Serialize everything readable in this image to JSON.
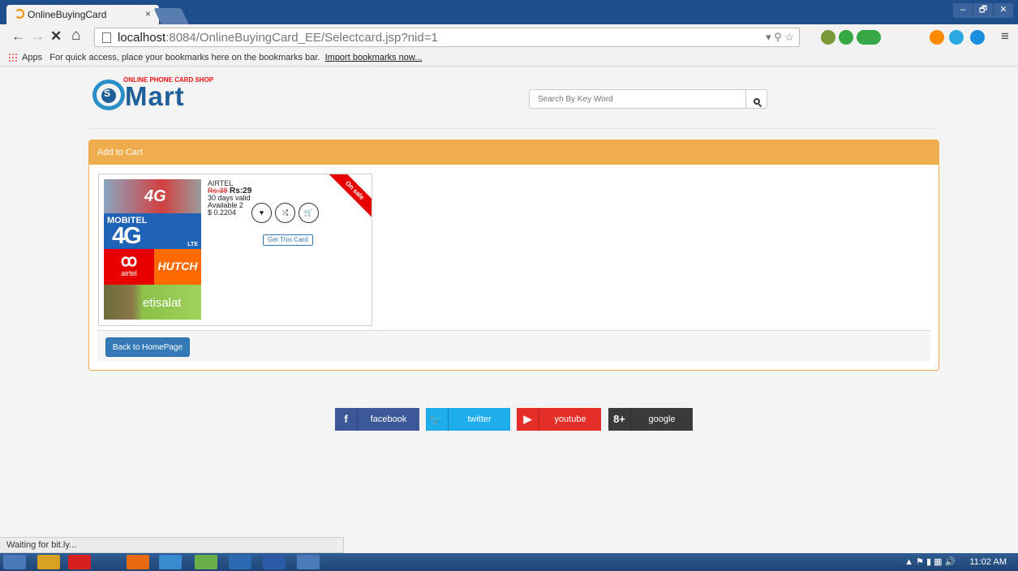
{
  "browser": {
    "tab_title": "OnlineBuyingCard",
    "tab_close": "×",
    "window_controls": {
      "minimize": "‒",
      "restore": "🗗",
      "close": "✕"
    },
    "url_host": "localhost",
    "url_rest": ":8084/OnlineBuyingCard_EE/Selectcard.jsp?nid=1",
    "omnibox_icons": "▾ ⚲ ☆",
    "nav": {
      "back": "←",
      "forward": "→",
      "stop": "✕",
      "home": "⌂"
    },
    "menu_icon": "≡",
    "bookmarks_apps": "Apps",
    "bookmarks_hint": "For quick access, place your bookmarks here on the bookmarks bar.",
    "bookmarks_import": "Import bookmarks now...",
    "status_text": "Waiting for bit.ly...",
    "extension_colors": [
      "#7a9a3a",
      "#35a845",
      "#35a845",
      "#ff8a00",
      "#2aa8e0",
      "#1a8fe0"
    ]
  },
  "header": {
    "logo_tagline": "ONLINE PHONE CARD SHOP",
    "logo_s": "S",
    "logo_word": "Mart",
    "search_placeholder": "Search By Key Word",
    "search_icon": "search-icon"
  },
  "panel": {
    "heading": "Add to Cart",
    "back_button": "Back to HomePage"
  },
  "card": {
    "image_4g": "4G",
    "mobitel_label": "MOBITEL",
    "mobitel_4g": "4G",
    "mobitel_lte": "LTE",
    "airtel_logo": "ꝏ",
    "airtel_word": "airtel",
    "hutch_word": "HUTCH",
    "etisalat_word": "etisalat",
    "provider": "AIRTEL",
    "old_price": "Rs:39",
    "new_price": "Rs:29",
    "validity": "30 days valid",
    "availability": "Available 2",
    "usd_price": "$ 0.2204",
    "ribbon": "On sale",
    "wishlist_glyph": "♥",
    "compare_glyph": "⤮",
    "cart_glyph": "🛒",
    "get_button": "Get This Card"
  },
  "social": [
    {
      "icon": "f",
      "label": "facebook"
    },
    {
      "icon": "🐦",
      "label": "twitter"
    },
    {
      "icon": "▶",
      "label": "youtube"
    },
    {
      "icon": "8+",
      "label": "google"
    }
  ],
  "taskbar": {
    "clock": "11:02 AM",
    "tray_icons": "▲ ⚑ ▮ ▦ 🔊",
    "item_colors": [
      "#4a78b8",
      "#d8a020",
      "#d62020",
      "#e86a10",
      "#3a8ad0",
      "#6ab04a",
      "#2a6ab0",
      "#2a5aa8",
      "#4a7ab8"
    ]
  }
}
